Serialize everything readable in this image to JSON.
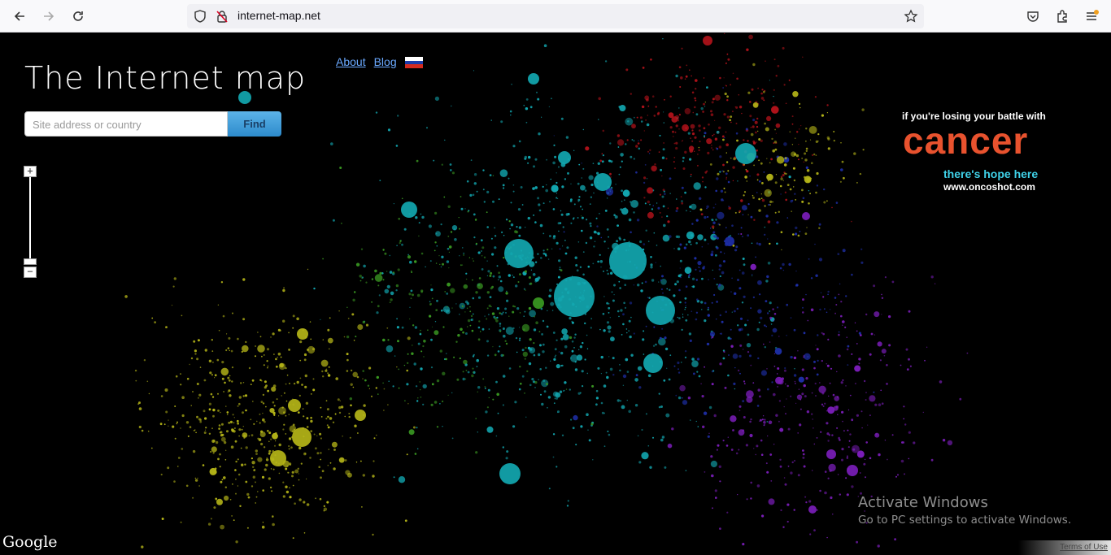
{
  "browser": {
    "url": "internet-map.net",
    "icons": [
      "back-icon",
      "forward-icon",
      "reload-icon",
      "shield-icon",
      "lock-icon",
      "star-icon",
      "pocket-icon",
      "extensions-icon",
      "menu-icon"
    ]
  },
  "site": {
    "title": "The Internet map",
    "search_placeholder": "Site address or country",
    "find_label": "Find",
    "nav": {
      "about": "About",
      "blog": "Blog"
    }
  },
  "zoom": {
    "plus": "+",
    "minus": "−"
  },
  "ad": {
    "line1": "if you're losing your battle with",
    "headline": "cancer",
    "line2": "there's hope here",
    "site": "www.oncoshot.com"
  },
  "windows": {
    "title": "Activate Windows",
    "subtitle": "Go to PC settings to activate Windows."
  },
  "footer": {
    "google": "Google",
    "terms": "Terms of Use"
  },
  "colors": {
    "teal": "#12a7b0",
    "yellow": "#b5b518",
    "purple": "#7a1db8",
    "red": "#b0121a",
    "blue": "#1e2fa8",
    "green": "#3a9a22",
    "accent_cancer": "#e8522e"
  }
}
